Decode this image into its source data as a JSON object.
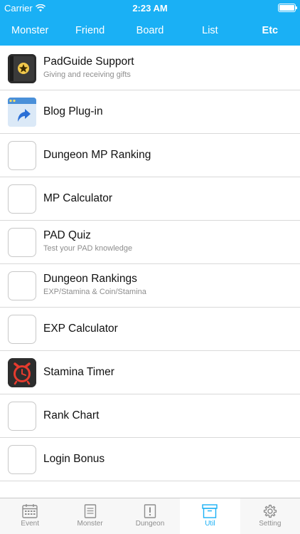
{
  "status": {
    "carrier": "Carrier",
    "time": "2:23 AM"
  },
  "topnav": {
    "tabs": [
      {
        "label": "Monster"
      },
      {
        "label": "Friend"
      },
      {
        "label": "Board"
      },
      {
        "label": "List"
      },
      {
        "label": "Etc"
      }
    ],
    "active": "Etc"
  },
  "items": [
    {
      "title": "PadGuide Support",
      "subtitle": "Giving and receiving gifts",
      "icon": "padguide-app-icon"
    },
    {
      "title": "Blog Plug-in",
      "subtitle": "",
      "icon": "blog-upload-icon"
    },
    {
      "title": "Dungeon MP Ranking",
      "subtitle": "",
      "icon": "blank-icon"
    },
    {
      "title": "MP Calculator",
      "subtitle": "",
      "icon": "blank-icon"
    },
    {
      "title": "PAD Quiz",
      "subtitle": "Test your PAD knowledge",
      "icon": "blank-icon"
    },
    {
      "title": "Dungeon Rankings",
      "subtitle": "EXP/Stamina & Coin/Stamina",
      "icon": "blank-icon"
    },
    {
      "title": "EXP Calculator",
      "subtitle": "",
      "icon": "blank-icon"
    },
    {
      "title": "Stamina Timer",
      "subtitle": "",
      "icon": "alarm-clock-icon"
    },
    {
      "title": "Rank Chart",
      "subtitle": "",
      "icon": "blank-icon"
    },
    {
      "title": "Login Bonus",
      "subtitle": "",
      "icon": "blank-icon"
    }
  ],
  "bottombar": {
    "tabs": [
      {
        "label": "Event",
        "icon": "calendar-icon"
      },
      {
        "label": "Monster",
        "icon": "document-icon"
      },
      {
        "label": "Dungeon",
        "icon": "book-icon"
      },
      {
        "label": "Util",
        "icon": "box-icon"
      },
      {
        "label": "Setting",
        "icon": "gear-icon"
      }
    ],
    "active": "Util"
  },
  "colors": {
    "accent": "#1ab0f5",
    "separator": "#d9d9d9",
    "subtitle": "#8e8e8e"
  }
}
